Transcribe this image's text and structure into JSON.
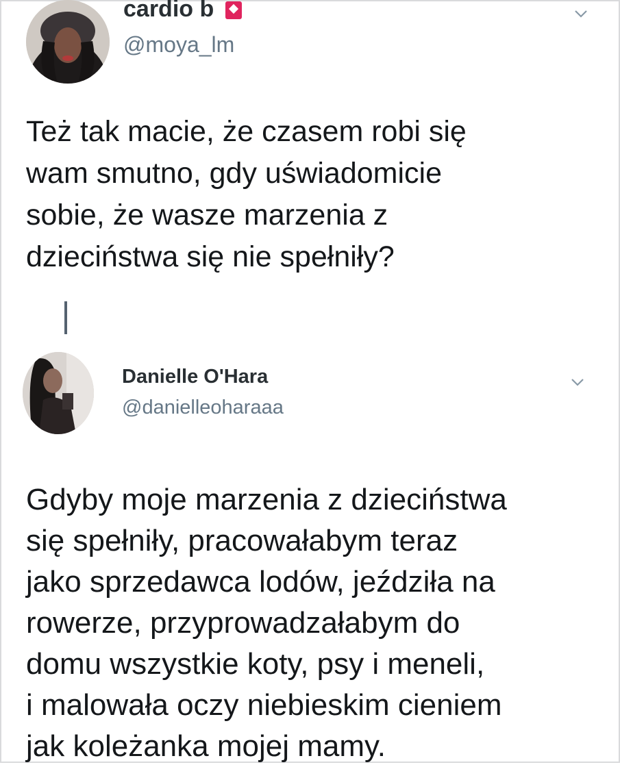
{
  "tweet_1": {
    "display_name": "cardio b",
    "handle": "@moya_lm",
    "text": "Też tak macie, że czasem robi się\nwam smutno, gdy uświadomicie\nsobie, że wasze marzenia z\ndzieciństwa się nie spełniły?",
    "badge_icon": "lock-badge-icon",
    "menu_icon": "chevron-down-icon"
  },
  "tweet_2": {
    "display_name": "Danielle O'Hara",
    "handle": "@danielleoharaaa",
    "text": "Gdyby moje marzenia z dzieciństwa\nsię spełniły, pracowałabym teraz\njako sprzedawca lodów, jeździła na\nrowerze, przyprowadzałabym do\ndomu wszystkie koty, psy i meneli,\ni malowała oczy niebieskim cieniem\njak koleżanka mojej mamy.",
    "menu_icon": "chevron-down-icon"
  },
  "colors": {
    "name": "#292f33",
    "handle": "#657786",
    "text": "#14171a",
    "badge": "#e0245e",
    "thread_line": "#556270"
  }
}
